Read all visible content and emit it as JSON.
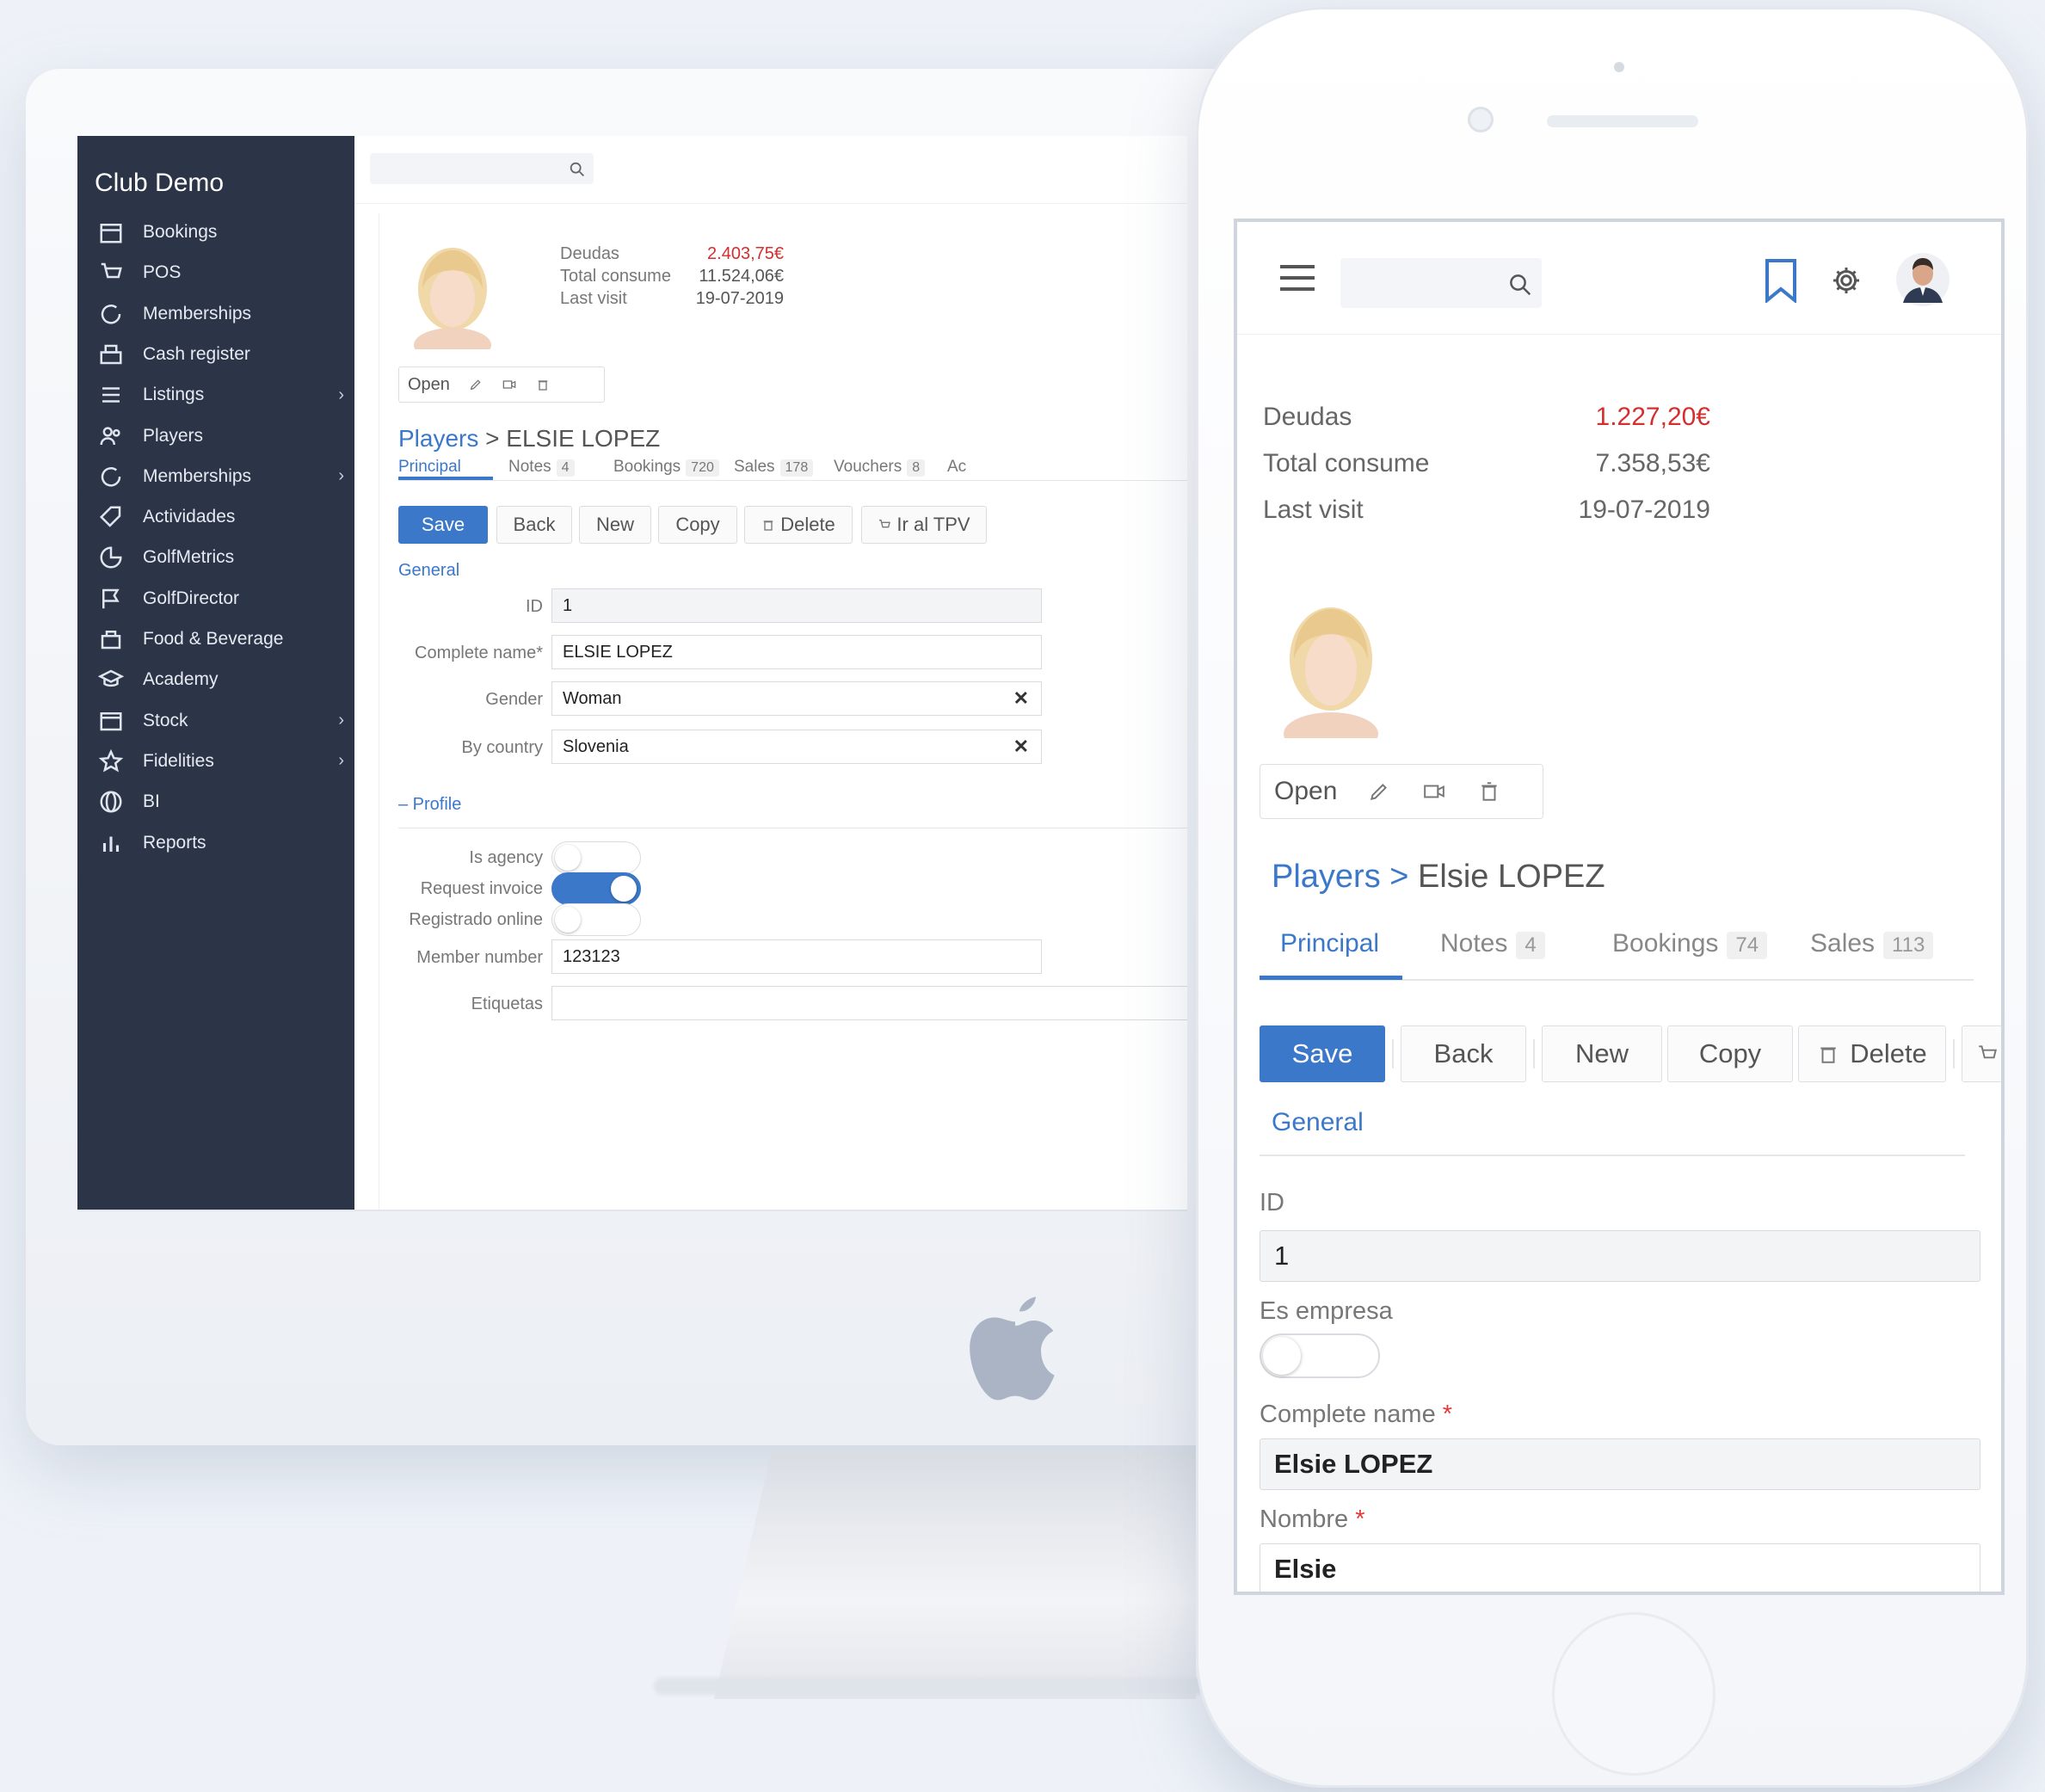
{
  "desktop": {
    "sidebar": {
      "title": "Club Demo",
      "items": [
        {
          "label": "Bookings",
          "icon": "calendar-icon",
          "chevron": ""
        },
        {
          "label": "POS",
          "icon": "cart-icon",
          "chevron": ""
        },
        {
          "label": "Memberships",
          "icon": "refresh-icon",
          "chevron": ""
        },
        {
          "label": "Cash register",
          "icon": "cash-register-icon",
          "chevron": ""
        },
        {
          "label": "Listings",
          "icon": "list-icon",
          "chevron": "›"
        },
        {
          "label": "Players",
          "icon": "users-icon",
          "chevron": ""
        },
        {
          "label": "Memberships",
          "icon": "refresh-icon",
          "chevron": "›"
        },
        {
          "label": "Actividades",
          "icon": "tag-icon",
          "chevron": ""
        },
        {
          "label": "GolfMetrics",
          "icon": "pie-chart-icon",
          "chevron": ""
        },
        {
          "label": "GolfDirector",
          "icon": "flag-icon",
          "chevron": ""
        },
        {
          "label": "Food & Beverage",
          "icon": "food-icon",
          "chevron": ""
        },
        {
          "label": "Academy",
          "icon": "academy-icon",
          "chevron": ""
        },
        {
          "label": "Stock",
          "icon": "box-icon",
          "chevron": "›"
        },
        {
          "label": "Fidelities",
          "icon": "star-icon",
          "chevron": "›"
        },
        {
          "label": "BI",
          "icon": "globe-icon",
          "chevron": ""
        },
        {
          "label": "Reports",
          "icon": "bar-chart-icon",
          "chevron": ""
        }
      ]
    },
    "stats": [
      {
        "label": "Deudas",
        "value": "2.403,75€",
        "color": "#d32f2f"
      },
      {
        "label": "Total consume",
        "value": "11.524,06€",
        "color": "#555555"
      },
      {
        "label": "Last visit",
        "value": "19-07-2019",
        "color": "#555555"
      }
    ],
    "mini_toolbar": {
      "open": "Open"
    },
    "breadcrumb": {
      "root": "Players",
      "sep": ">",
      "current": "ELSIE LOPEZ"
    },
    "tabs": [
      {
        "label": "Principal",
        "count": ""
      },
      {
        "label": "Notes",
        "count": "4"
      },
      {
        "label": "Bookings",
        "count": "720"
      },
      {
        "label": "Sales",
        "count": "178"
      },
      {
        "label": "Vouchers",
        "count": "8"
      },
      {
        "label": "Ac",
        "count": ""
      }
    ],
    "buttons": {
      "save": "Save",
      "back": "Back",
      "new": "New",
      "copy": "Copy",
      "delete": "Delete",
      "tpv": "Ir al TPV"
    },
    "section_general": "General",
    "fields": {
      "id": {
        "label": "ID",
        "value": "1"
      },
      "complete_name": {
        "label": "Complete name*",
        "value": "ELSIE LOPEZ"
      },
      "gender": {
        "label": "Gender",
        "value": "Woman"
      },
      "country": {
        "label": "By country",
        "value": "Slovenia"
      }
    },
    "section_profile": "– Profile",
    "toggles": [
      {
        "label": "Is agency",
        "on": false
      },
      {
        "label": "Request invoice",
        "on": true
      },
      {
        "label": "Registrado online",
        "on": false
      }
    ],
    "member_number": {
      "label": "Member number",
      "value": "123123"
    },
    "empty_field_label": "Etiquetas"
  },
  "phone": {
    "stats": [
      {
        "label": "Deudas",
        "value": "1.227,20€",
        "color": "#d32f2f"
      },
      {
        "label": "Total consume",
        "value": "7.358,53€",
        "color": "#666666"
      },
      {
        "label": "Last visit",
        "value": "19-07-2019",
        "color": "#666666"
      }
    ],
    "mini_toolbar": {
      "open": "Open"
    },
    "breadcrumb": {
      "root": "Players",
      "sep": ">",
      "current": "Elsie LOPEZ"
    },
    "tabs": [
      {
        "label": "Principal",
        "count": ""
      },
      {
        "label": "Notes",
        "count": "4"
      },
      {
        "label": "Bookings",
        "count": "74"
      },
      {
        "label": "Sales",
        "count": "113"
      }
    ],
    "buttons": {
      "save": "Save",
      "back": "Back",
      "new": "New",
      "copy": "Copy",
      "delete": "Delete"
    },
    "section_general": "General",
    "fields": {
      "id": {
        "label": "ID",
        "value": "1"
      },
      "es_empresa": {
        "label": "Es empresa",
        "on": false
      },
      "complete_name": {
        "label": "Complete name",
        "required": "*",
        "value": "Elsie LOPEZ"
      },
      "nombre": {
        "label": "Nombre",
        "required": "*",
        "value": "Elsie"
      }
    }
  },
  "colors": {
    "accent": "#3b78c9",
    "sidebar": "#2c3447",
    "debt": "#d32f2f"
  }
}
